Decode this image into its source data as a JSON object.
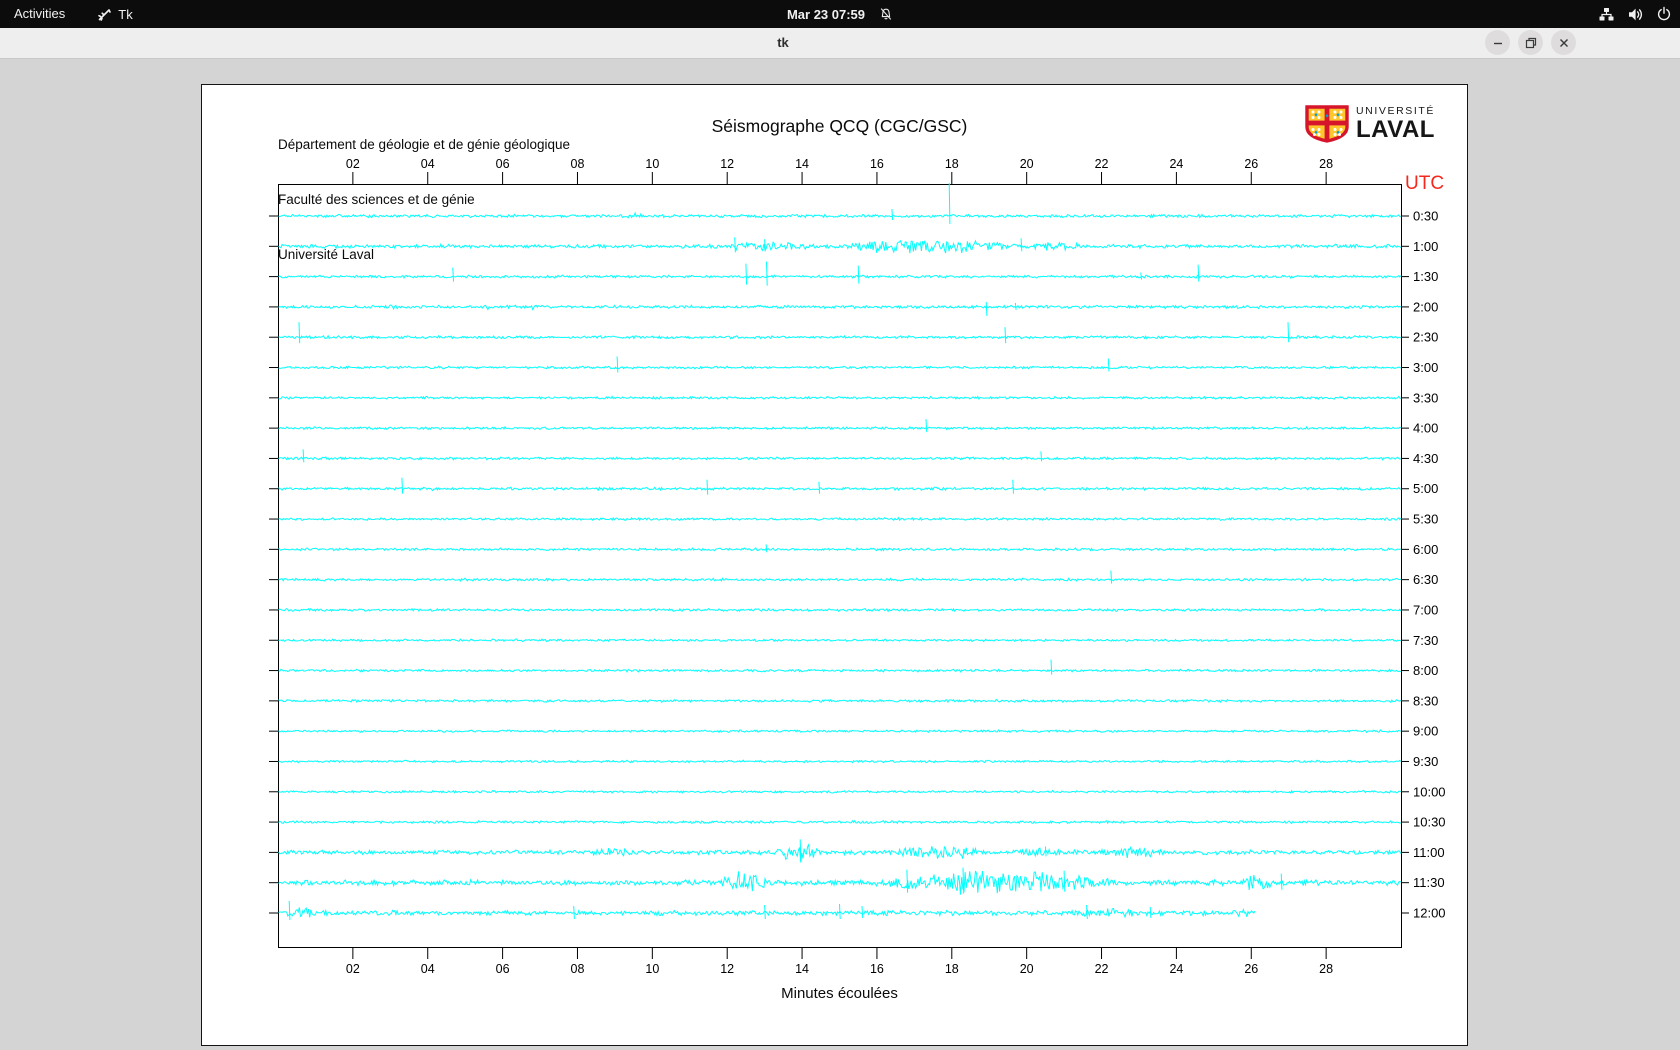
{
  "desktop": {
    "activities_label": "Activities",
    "app_name": "Tk",
    "clock": "Mar 23  07:59",
    "status_icons": [
      "network-wired-icon",
      "volume-icon",
      "power-icon"
    ],
    "notifications_icon": "notifications-off-bell-icon"
  },
  "window": {
    "title": "tk",
    "controls": {
      "minimize": "minimize-button",
      "maximize": "maximize-button",
      "close": "close-button"
    }
  },
  "seismograph": {
    "header_lines": [
      "Département de géologie et de génie géologique",
      "Faculté des sciences et de génie",
      "Université Laval"
    ],
    "title": "Séismographe QCQ (CGC/GSC)",
    "utc_label": "UTC",
    "xlabel": "Minutes écoulées",
    "logo": {
      "line1": "UNIVERSITÉ",
      "line2": "LAVAL"
    },
    "colors": {
      "trace": "#00ffff",
      "utc_label": "#f4281c",
      "axis": "#000000",
      "canvas_bg": "#ffffff",
      "window_bg": "#d4d4d4",
      "topbar_bg": "#0c0c0c",
      "titlebar_bg": "#efeeee",
      "logo_red": "#d6152c",
      "logo_gold": "#ffc72c",
      "logo_blue": "#00a0dc"
    },
    "chart_data": {
      "type": "line",
      "title": "Séismographe QCQ (CGC/GSC)",
      "xlabel": "Minutes écoulées",
      "x_range_minutes": [
        0,
        30
      ],
      "x_ticks": [
        "02",
        "04",
        "06",
        "08",
        "10",
        "12",
        "14",
        "16",
        "18",
        "20",
        "22",
        "24",
        "26",
        "28"
      ],
      "y_axis_side": "right",
      "y_unit": "UTC",
      "grid": false,
      "rows": [
        {
          "label": "0:30",
          "base": 1.2,
          "bursts": [
            [
              9.25,
              9.75,
              2.2
            ]
          ],
          "spikes": [
            [
              16.4,
              7,
              4
            ],
            [
              17.93,
              33,
              8
            ]
          ]
        },
        {
          "label": "1:00",
          "base": 1.5,
          "bursts": [
            [
              11.3,
              14.8,
              3
            ],
            [
              14.8,
              19.9,
              6.5
            ],
            [
              19.9,
              21.6,
              2.5
            ]
          ],
          "spikes": [
            [
              12.2,
              9,
              6
            ],
            [
              13.0,
              7,
              5
            ],
            [
              19.85,
              8,
              5
            ]
          ]
        },
        {
          "label": "1:30",
          "base": 1.1,
          "bursts": [],
          "spikes": [
            [
              4.67,
              9,
              5
            ],
            [
              12.5,
              13,
              8
            ],
            [
              13.05,
              15,
              9
            ],
            [
              15.5,
              11,
              7
            ],
            [
              23.05,
              4,
              3
            ],
            [
              24.58,
              12,
              5
            ]
          ]
        },
        {
          "label": "2:00",
          "base": 1.2,
          "bursts": [
            [
              2.9,
              3.2,
              2.2
            ],
            [
              5.5,
              5.8,
              2.2
            ],
            [
              6.65,
              7.0,
              2.2
            ]
          ],
          "spikes": [
            [
              18.92,
              5,
              9
            ],
            [
              19.7,
              4,
              3
            ]
          ]
        },
        {
          "label": "2:30",
          "base": 1.1,
          "bursts": [],
          "spikes": [
            [
              0.56,
              15,
              6
            ],
            [
              19.42,
              10,
              6
            ],
            [
              26.98,
              15,
              5
            ]
          ]
        },
        {
          "label": "3:00",
          "base": 1.0,
          "bursts": [],
          "spikes": [
            [
              9.06,
              11,
              5
            ],
            [
              22.18,
              9,
              4
            ]
          ]
        },
        {
          "label": "3:30",
          "base": 1.0,
          "bursts": [],
          "spikes": []
        },
        {
          "label": "4:00",
          "base": 1.0,
          "bursts": [],
          "spikes": [
            [
              17.31,
              9,
              4
            ]
          ]
        },
        {
          "label": "4:30",
          "base": 1.0,
          "bursts": [],
          "spikes": [
            [
              0.67,
              9,
              4
            ],
            [
              20.38,
              7,
              3
            ]
          ]
        },
        {
          "label": "5:00",
          "base": 1.1,
          "bursts": [
            [
              4.0,
              4.25,
              2.2
            ],
            [
              17.45,
              17.7,
              2.2
            ]
          ],
          "spikes": [
            [
              3.31,
              11,
              5
            ],
            [
              11.46,
              9,
              6
            ],
            [
              14.45,
              7,
              5
            ],
            [
              19.63,
              9,
              5
            ]
          ]
        },
        {
          "label": "5:30",
          "base": 1.0,
          "bursts": [],
          "spikes": []
        },
        {
          "label": "6:00",
          "base": 1.0,
          "bursts": [],
          "spikes": [
            [
              13.04,
              5,
              3
            ]
          ]
        },
        {
          "label": "6:30",
          "base": 1.0,
          "bursts": [],
          "spikes": [
            [
              22.25,
              9,
              4
            ]
          ]
        },
        {
          "label": "7:00",
          "base": 1.0,
          "bursts": [],
          "spikes": []
        },
        {
          "label": "7:30",
          "base": 0.9,
          "bursts": [],
          "spikes": []
        },
        {
          "label": "8:00",
          "base": 1.0,
          "bursts": [],
          "spikes": [
            [
              20.65,
              11,
              4
            ]
          ]
        },
        {
          "label": "8:30",
          "base": 1.0,
          "bursts": [],
          "spikes": []
        },
        {
          "label": "9:00",
          "base": 0.9,
          "bursts": [],
          "spikes": []
        },
        {
          "label": "9:30",
          "base": 0.9,
          "bursts": [],
          "spikes": []
        },
        {
          "label": "10:00",
          "base": 0.9,
          "bursts": [],
          "spikes": []
        },
        {
          "label": "10:30",
          "base": 1.0,
          "bursts": [],
          "spikes": []
        },
        {
          "label": "11:00",
          "base": 1.8,
          "bursts": [
            [
              8.2,
              9.6,
              3
            ],
            [
              13.3,
              14.6,
              9
            ],
            [
              16.3,
              19.0,
              6
            ],
            [
              19.8,
              21.0,
              3
            ],
            [
              21.9,
              23.7,
              4.5
            ]
          ],
          "spikes": [
            [
              13.95,
              13,
              9
            ],
            [
              20.5,
              6,
              4
            ]
          ]
        },
        {
          "label": "11:30",
          "base": 2.2,
          "bursts": [
            [
              11.8,
              13.2,
              10
            ],
            [
              15.9,
              22.5,
              11
            ],
            [
              25.7,
              26.6,
              8
            ]
          ],
          "spikes": [
            [
              16.8,
              13,
              10
            ],
            [
              18.3,
              15,
              11
            ],
            [
              21.0,
              12,
              9
            ],
            [
              26.8,
              9,
              7
            ]
          ]
        },
        {
          "label": "12:00",
          "base": 2.0,
          "end": 26.1,
          "bursts": [
            [
              0.1,
              1.0,
              4
            ],
            [
              21.2,
              22.9,
              3.5
            ],
            [
              25.4,
              26.1,
              4
            ]
          ],
          "spikes": [
            [
              0.3,
              12,
              7
            ],
            [
              7.9,
              7,
              6
            ],
            [
              13.0,
              8,
              6
            ],
            [
              15.0,
              9,
              6
            ],
            [
              15.6,
              7,
              5
            ],
            [
              21.6,
              8,
              6
            ],
            [
              23.3,
              6,
              5
            ]
          ]
        }
      ]
    }
  }
}
